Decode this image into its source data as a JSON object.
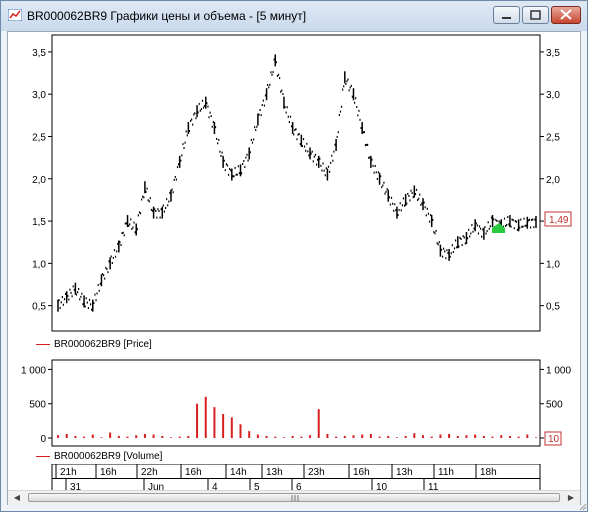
{
  "window": {
    "title": "BR000062BR9 Графики цены и объема - [5 минут]",
    "buttons": [
      "minimize-icon",
      "restore-icon",
      "close-icon"
    ]
  },
  "price_chart": {
    "y_ticks": [
      "0,5",
      "1,0",
      "1,5",
      "2,0",
      "2,5",
      "3,0",
      "3,5"
    ],
    "last_price": "1,49",
    "legend": "BR000062BR9 [Price]",
    "series_color": "#d62020",
    "marker_color": "#27c93f"
  },
  "volume_chart": {
    "y_ticks": [
      "0",
      "500",
      "1 000"
    ],
    "last_volume": "10",
    "legend": "BR000062BR9 [Volume]",
    "bar_color": "#d62020"
  },
  "time_axis": {
    "hours": [
      "21h",
      "16h",
      "22h",
      "16h",
      "14h",
      "13h",
      "23h",
      "16h",
      "13h",
      "11h",
      "18h"
    ],
    "dates": [
      "31",
      "Jun",
      "4",
      "5",
      "6",
      "10",
      "11"
    ]
  },
  "chart_data": [
    {
      "type": "scatter",
      "title": "",
      "series": [
        {
          "name": "BR000062BR9 [Price]",
          "values": [
            0.5,
            0.6,
            0.7,
            0.55,
            0.5,
            0.8,
            1.0,
            1.2,
            1.5,
            1.4,
            1.9,
            1.6,
            1.6,
            1.8,
            2.2,
            2.6,
            2.8,
            2.9,
            2.6,
            2.2,
            2.05,
            2.1,
            2.3,
            2.7,
            3.0,
            3.4,
            2.9,
            2.6,
            2.45,
            2.3,
            2.2,
            2.05,
            2.4,
            3.2,
            3.0,
            2.6,
            2.2,
            2.0,
            1.8,
            1.6,
            1.75,
            1.85,
            1.7,
            1.5,
            1.15,
            1.1,
            1.25,
            1.3,
            1.45,
            1.35,
            1.5,
            1.45,
            1.5,
            1.45,
            1.48,
            1.49
          ]
        }
      ],
      "ylim": [
        0.2,
        3.7
      ],
      "ylabel": "",
      "xlabel": ""
    },
    {
      "type": "bar",
      "title": "",
      "series": [
        {
          "name": "BR000062BR9 [Volume]",
          "values": [
            40,
            60,
            30,
            20,
            50,
            10,
            80,
            30,
            20,
            40,
            60,
            50,
            30,
            10,
            20,
            30,
            500,
            600,
            450,
            350,
            300,
            200,
            100,
            50,
            30,
            20,
            10,
            30,
            20,
            40,
            420,
            60,
            20,
            30,
            40,
            50,
            60,
            20,
            30,
            10,
            30,
            70,
            40,
            20,
            50,
            60,
            30,
            40,
            50,
            30,
            20,
            40,
            30,
            20,
            50,
            10
          ]
        }
      ],
      "ylim": [
        0,
        1050
      ]
    }
  ]
}
